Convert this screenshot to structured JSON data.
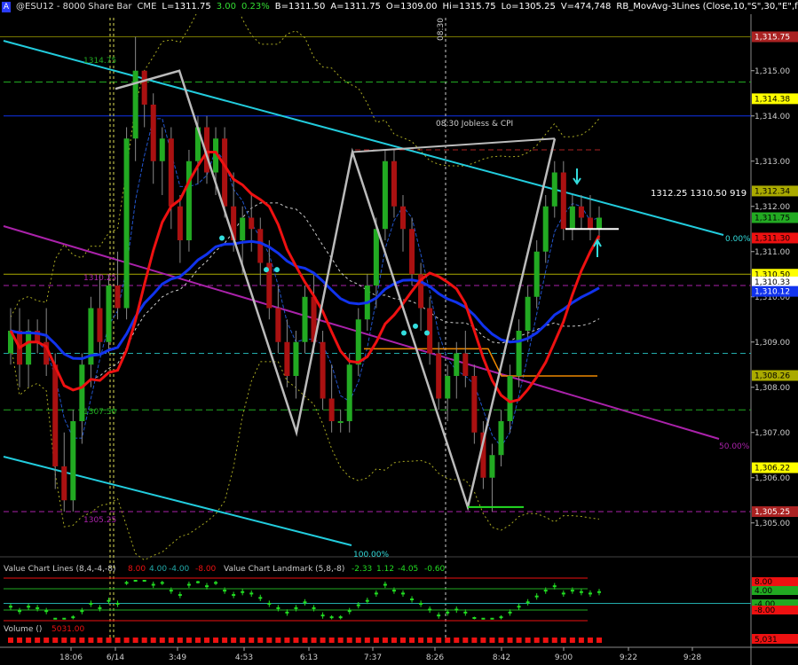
{
  "header": {
    "a_button": "A",
    "symbol": "@ESU12 - 8000 Share Bar",
    "exchange": "CME",
    "last": "L=1311.75",
    "change": "3.00",
    "change_pct": "0.23%",
    "bid": "B=1311.50",
    "ask": "A=1311.75",
    "open": "O=1309.00",
    "high": "Hi=1315.75",
    "low": "Lo=1305.25",
    "volume": "V=474,748",
    "indicator": "RB_MovAvg-3Lines (Close,10,\"S\",30,\"E\",false"
  },
  "colors": {
    "up_bar": "#22aa22",
    "down_bar": "#aa1111",
    "cyan_line": "#22ccdd",
    "purple_line": "#aa22aa",
    "red_ma": "#ee1111",
    "blue_ma": "#1133ee",
    "gray_zigzag": "#bbbbbb",
    "orange_line": "#ee8800",
    "green_dash": "#22aa22",
    "yellow_line": "#aaaa00"
  },
  "annotations": {
    "jobless": "08:30 Jobless & CPI",
    "time_marker": "08:30",
    "quote_box": "1312.25  1310.50  919",
    "fib_0": "0.00%",
    "fib_50": "50.00%",
    "fib_100": "100.00%",
    "lvl_131475": "1314.75",
    "lvl_131025": "1310.25",
    "lvl_130750": "1307.50",
    "lvl_130525": "1305.25"
  },
  "price_axis": {
    "ticks": [
      "1,315.00",
      "1,314.00",
      "1,313.00",
      "1,312.00",
      "1,311.00",
      "1,310.00",
      "1,309.00",
      "1,308.00",
      "1,307.00",
      "1,306.00",
      "1,305.00"
    ],
    "price_labels": [
      {
        "text": "1,315.75",
        "price": 1315.75,
        "bg": "#aa2222",
        "fg": "#ffffff"
      },
      {
        "text": "1,314.38",
        "price": 1314.38,
        "bg": "#ffff00",
        "fg": "#000000"
      },
      {
        "text": "1,312.34",
        "price": 1312.34,
        "bg": "#aaaa00",
        "fg": "#000000"
      },
      {
        "text": "1,311.75",
        "price": 1311.75,
        "bg": "#22aa22",
        "fg": "#000000"
      },
      {
        "text": "1,311.30",
        "price": 1311.3,
        "bg": "#ee1111",
        "fg": "#000000"
      },
      {
        "text": "1,310.50",
        "price": 1310.5,
        "bg": "#ffff00",
        "fg": "#000000"
      },
      {
        "text": "1,310.33",
        "price": 1310.33,
        "bg": "#ffffff",
        "fg": "#000000"
      },
      {
        "text": "1,310.12",
        "price": 1310.12,
        "bg": "#1133ee",
        "fg": "#ffffff"
      },
      {
        "text": "1,308.26",
        "price": 1308.26,
        "bg": "#aaaa00",
        "fg": "#000000"
      },
      {
        "text": "1,306.22",
        "price": 1306.22,
        "bg": "#ffff00",
        "fg": "#000000"
      },
      {
        "text": "1,305.25",
        "price": 1305.25,
        "bg": "#aa2222",
        "fg": "#ffffff"
      }
    ]
  },
  "time_axis": [
    "18:06",
    "6/14",
    "3:49",
    "4:53",
    "6:13",
    "7:37",
    "8:26",
    "8:42",
    "9:00",
    "9:22",
    "9:28"
  ],
  "value_chart": {
    "title": "Value Chart Lines (8,4,-4,-8)",
    "v1": "8.00",
    "v2": "4.00",
    "v3": "-4.00",
    "v4": "-8.00",
    "landmark": "Value Chart Landmark (5,8,-8)",
    "l1": "-2.33",
    "l2": "1.12",
    "l3": "-4.05",
    "l4": "-0.60",
    "labels": [
      {
        "text": "8.00",
        "bg": "#ee1111",
        "fg": "#000000"
      },
      {
        "text": "4.00",
        "bg": "#22aa22",
        "fg": "#000000"
      },
      {
        "text": "-4.00",
        "bg": "#22aa22",
        "fg": "#000000"
      },
      {
        "text": "-8.00",
        "bg": "#ee1111",
        "fg": "#000000"
      }
    ]
  },
  "volume_panel": {
    "title": "Volume ()",
    "value": "5031.00",
    "label": "5,031"
  },
  "chart_data": {
    "type": "candlestick",
    "title": "@ESU12 - 8000 Share Bar",
    "ylim": [
      1304.25,
      1316.25
    ],
    "bars": [
      [
        1308.75,
        1309.75,
        1308.5,
        1309.25
      ],
      [
        1309.25,
        1309.75,
        1308.0,
        1308.5
      ],
      [
        1308.5,
        1309.5,
        1308.0,
        1309.25
      ],
      [
        1309.25,
        1309.5,
        1308.75,
        1309.0
      ],
      [
        1309.0,
        1309.75,
        1308.25,
        1308.5
      ],
      [
        1308.5,
        1308.75,
        1305.75,
        1306.25
      ],
      [
        1306.25,
        1307.0,
        1305.25,
        1305.5
      ],
      [
        1305.5,
        1307.5,
        1305.25,
        1307.25
      ],
      [
        1307.25,
        1308.75,
        1306.75,
        1308.5
      ],
      [
        1308.5,
        1310.0,
        1308.0,
        1309.75
      ],
      [
        1309.75,
        1310.5,
        1308.75,
        1309.0
      ],
      [
        1309.0,
        1310.5,
        1308.75,
        1310.25
      ],
      [
        1310.25,
        1311.0,
        1309.5,
        1309.75
      ],
      [
        1309.75,
        1313.75,
        1309.5,
        1313.5
      ],
      [
        1313.5,
        1315.75,
        1313.0,
        1315.0
      ],
      [
        1315.0,
        1315.0,
        1313.75,
        1314.25
      ],
      [
        1314.25,
        1314.5,
        1312.5,
        1313.0
      ],
      [
        1313.0,
        1313.75,
        1312.25,
        1313.5
      ],
      [
        1313.5,
        1313.75,
        1311.5,
        1312.0
      ],
      [
        1312.0,
        1312.25,
        1310.75,
        1311.25
      ],
      [
        1311.25,
        1313.25,
        1311.0,
        1313.0
      ],
      [
        1313.0,
        1314.0,
        1312.5,
        1313.75
      ],
      [
        1313.75,
        1314.0,
        1312.5,
        1312.75
      ],
      [
        1312.75,
        1313.75,
        1312.25,
        1313.5
      ],
      [
        1313.5,
        1313.75,
        1311.75,
        1312.0
      ],
      [
        1312.0,
        1312.75,
        1311.0,
        1311.25
      ],
      [
        1311.25,
        1312.0,
        1310.5,
        1311.75
      ],
      [
        1311.75,
        1312.25,
        1311.0,
        1311.5
      ],
      [
        1311.5,
        1311.75,
        1310.25,
        1310.75
      ],
      [
        1310.75,
        1311.25,
        1309.5,
        1309.75
      ],
      [
        1309.75,
        1310.25,
        1308.75,
        1309.0
      ],
      [
        1309.0,
        1309.5,
        1308.0,
        1308.25
      ],
      [
        1308.25,
        1309.25,
        1307.75,
        1309.0
      ],
      [
        1309.0,
        1310.25,
        1308.75,
        1310.0
      ],
      [
        1310.0,
        1310.5,
        1308.75,
        1309.0
      ],
      [
        1309.0,
        1309.25,
        1307.5,
        1307.75
      ],
      [
        1307.75,
        1308.5,
        1307.0,
        1307.25
      ],
      [
        1307.25,
        1307.5,
        1307.0,
        1307.25
      ],
      [
        1307.25,
        1308.75,
        1307.0,
        1308.5
      ],
      [
        1308.5,
        1309.75,
        1308.25,
        1309.5
      ],
      [
        1309.5,
        1310.5,
        1309.25,
        1310.25
      ],
      [
        1310.25,
        1311.75,
        1309.75,
        1311.5
      ],
      [
        1311.5,
        1313.25,
        1311.25,
        1313.0
      ],
      [
        1313.0,
        1313.25,
        1311.75,
        1312.0
      ],
      [
        1312.0,
        1312.25,
        1311.0,
        1311.5
      ],
      [
        1311.5,
        1311.75,
        1310.25,
        1310.5
      ],
      [
        1310.5,
        1310.75,
        1309.25,
        1309.75
      ],
      [
        1309.75,
        1310.0,
        1308.5,
        1308.75
      ],
      [
        1308.75,
        1309.0,
        1307.5,
        1307.75
      ],
      [
        1307.75,
        1308.5,
        1307.25,
        1308.25
      ],
      [
        1308.25,
        1309.0,
        1307.75,
        1308.75
      ],
      [
        1308.75,
        1309.25,
        1308.0,
        1308.25
      ],
      [
        1308.25,
        1308.5,
        1306.75,
        1307.0
      ],
      [
        1307.0,
        1307.25,
        1305.75,
        1306.0
      ],
      [
        1306.0,
        1306.75,
        1305.25,
        1306.5
      ],
      [
        1306.5,
        1307.5,
        1306.25,
        1307.25
      ],
      [
        1307.25,
        1308.5,
        1307.0,
        1308.25
      ],
      [
        1308.25,
        1309.5,
        1308.0,
        1309.25
      ],
      [
        1309.25,
        1310.25,
        1309.0,
        1310.0
      ],
      [
        1310.0,
        1311.25,
        1309.75,
        1311.0
      ],
      [
        1311.0,
        1312.25,
        1310.75,
        1312.0
      ],
      [
        1312.0,
        1313.0,
        1311.75,
        1312.75
      ],
      [
        1312.75,
        1313.0,
        1311.25,
        1311.5
      ],
      [
        1311.5,
        1312.25,
        1311.25,
        1312.0
      ],
      [
        1312.0,
        1312.25,
        1311.5,
        1311.75
      ],
      [
        1311.75,
        1312.25,
        1311.25,
        1311.5
      ],
      [
        1311.5,
        1312.0,
        1311.25,
        1311.75
      ]
    ]
  }
}
